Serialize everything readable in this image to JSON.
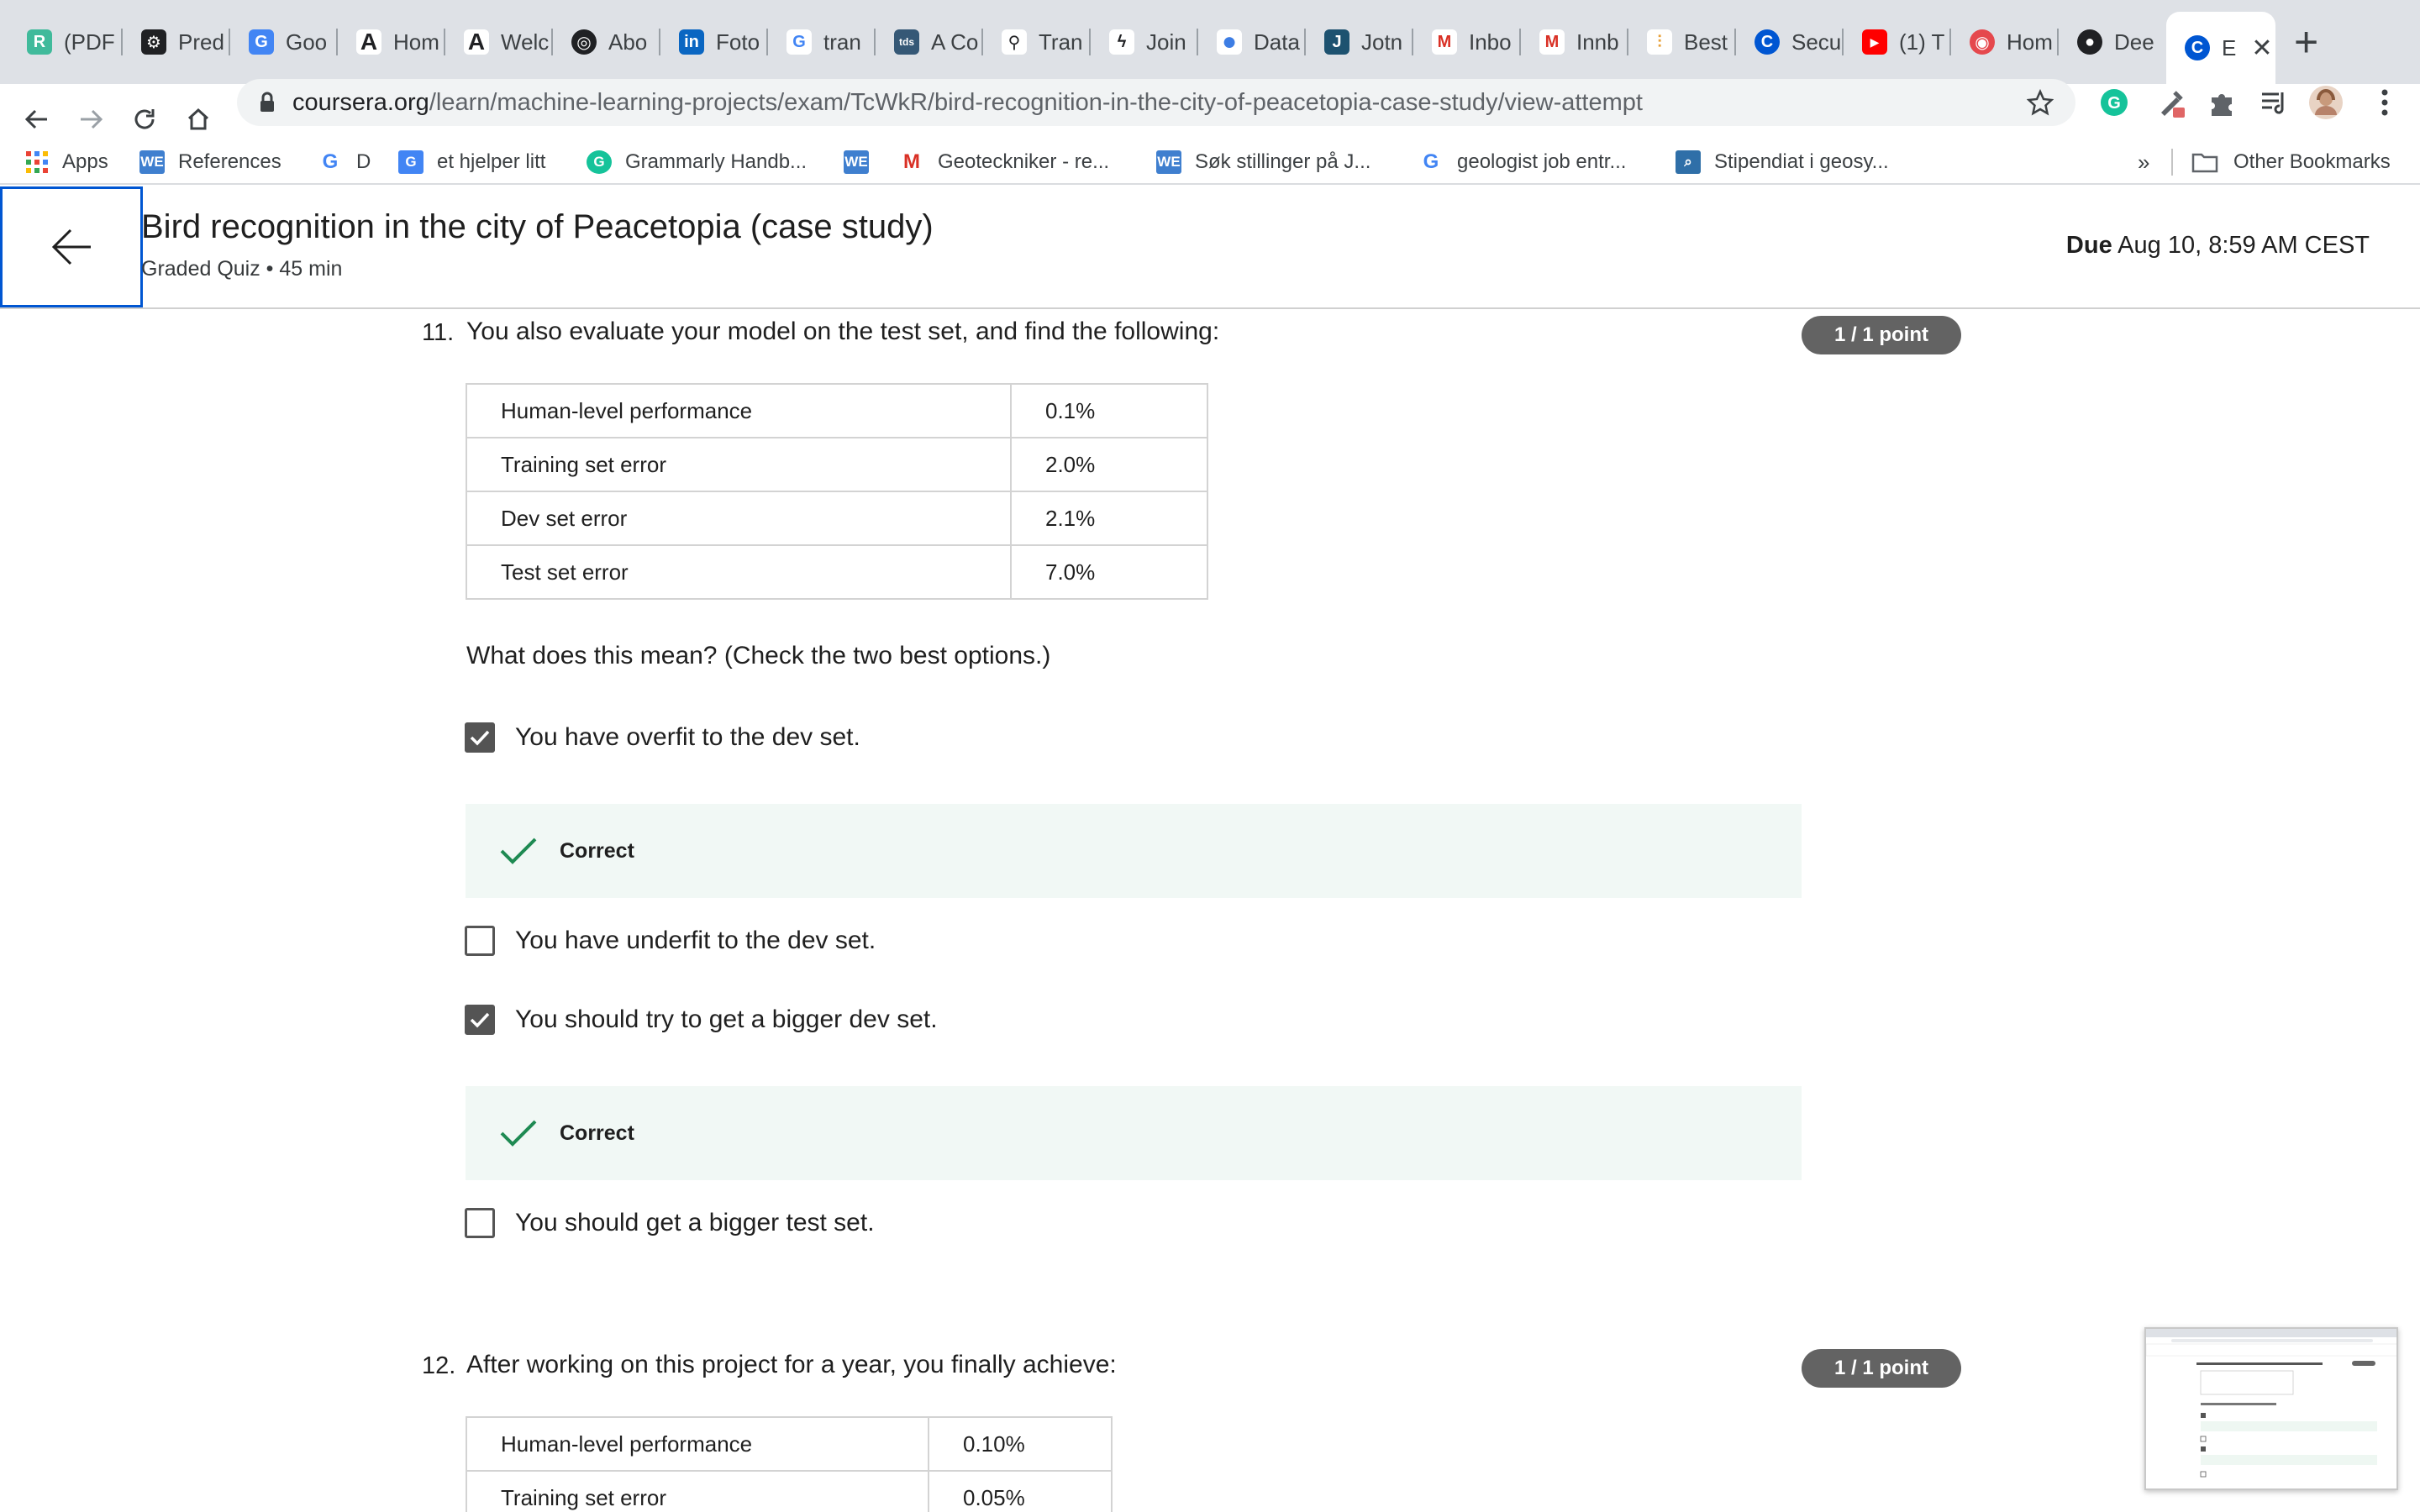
{
  "browser": {
    "tabs": [
      {
        "label": "(PDF",
        "icon": "researchgate-icon",
        "color": "#40ba9b",
        "glyph": "R"
      },
      {
        "label": "Pred",
        "icon": "gear-icon",
        "color": "#202124",
        "glyph": "⚙"
      },
      {
        "label": "Goo",
        "icon": "google-translate-icon",
        "color": "#4285f4",
        "glyph": "G"
      },
      {
        "label": "Hom",
        "icon": "anthropic-icon",
        "color": "#202124",
        "glyph": "A"
      },
      {
        "label": "Welc",
        "icon": "anthropic-icon",
        "color": "#202124",
        "glyph": "A"
      },
      {
        "label": "Abo",
        "icon": "openai-icon",
        "color": "#202124",
        "glyph": "◎"
      },
      {
        "label": "Foto",
        "icon": "linkedin-icon",
        "color": "#0a66c2",
        "glyph": "in"
      },
      {
        "label": "tran",
        "icon": "google-icon",
        "color": "#ffffff",
        "glyph": "G"
      },
      {
        "label": "A Co",
        "icon": "tds-icon",
        "color": "#355876",
        "glyph": "tds"
      },
      {
        "label": "Tran",
        "icon": "bike-icon",
        "color": "#ffffff",
        "glyph": "⚲"
      },
      {
        "label": "Join",
        "icon": "slash-icon",
        "color": "#ffffff",
        "glyph": "ϟ"
      },
      {
        "label": "Data",
        "icon": "drop-icon",
        "color": "#3d7de4",
        "glyph": "●"
      },
      {
        "label": "Jotn",
        "icon": "jotform-icon",
        "color": "#1d5270",
        "glyph": "J"
      },
      {
        "label": "Inbo",
        "icon": "gmail-icon",
        "color": "#ffffff",
        "glyph": "M"
      },
      {
        "label": "Innb",
        "icon": "gmail-icon",
        "color": "#ffffff",
        "glyph": "M"
      },
      {
        "label": "Best",
        "icon": "chart-icon",
        "color": "#ffffff",
        "glyph": "⫶"
      },
      {
        "label": "Secu",
        "icon": "coursera-icon",
        "color": "#0056d2",
        "glyph": "C"
      },
      {
        "label": "(1) T",
        "icon": "youtube-icon",
        "color": "#ff0000",
        "glyph": "▶"
      },
      {
        "label": "Hom",
        "icon": "target-icon",
        "color": "#e5484d",
        "glyph": "◉"
      },
      {
        "label": "Dee",
        "icon": "github-icon",
        "color": "#202124",
        "glyph": "●"
      },
      {
        "label": "E",
        "icon": "coursera-icon",
        "color": "#0056d2",
        "glyph": "C"
      }
    ],
    "url_host": "coursera.org",
    "url_path": "/learn/machine-learning-projects/exam/TcWkR/bird-recognition-in-the-city-of-peacetopia-case-study/view-attempt",
    "bookmarks": [
      {
        "label": "Apps",
        "icon": "apps-grid-icon"
      },
      {
        "label": "References",
        "icon": "we-icon"
      },
      {
        "label": "D",
        "icon": "google-icon"
      },
      {
        "label": "et hjelper litt",
        "icon": "google-translate-icon"
      },
      {
        "label": "Grammarly Handb...",
        "icon": "grammarly-icon"
      },
      {
        "label": "",
        "icon": "we-icon"
      },
      {
        "label": "Geoteckniker - re...",
        "icon": "gmail-icon"
      },
      {
        "label": "Søk stillinger på J...",
        "icon": "we-icon"
      },
      {
        "label": "geologist job entr...",
        "icon": "google-icon"
      },
      {
        "label": "Stipendiat i geosy...",
        "icon": "search-icon"
      }
    ],
    "bookmarks_overflow": "»",
    "other_bookmarks": "Other Bookmarks"
  },
  "header": {
    "title": "Bird recognition in the city of Peacetopia (case study)",
    "meta": "Graded Quiz • 45 min",
    "due_label": "Due",
    "due_value": "Aug 10, 8:59 AM CEST"
  },
  "q11": {
    "number": "11.",
    "text": "You also evaluate your model on the test set, and find the following:",
    "points": "1 / 1 point",
    "table": [
      {
        "label": "Human-level performance",
        "value": "0.1%"
      },
      {
        "label": "Training set error",
        "value": "2.0%"
      },
      {
        "label": "Dev set error",
        "value": "2.1%"
      },
      {
        "label": "Test set error",
        "value": "7.0%"
      }
    ],
    "prompt": "What does this mean? (Check the two best options.)",
    "options": [
      {
        "text": "You have overfit to the dev set.",
        "checked": true,
        "feedback": "Correct"
      },
      {
        "text": "You have underfit to the dev set.",
        "checked": false,
        "feedback": ""
      },
      {
        "text": "You should try to get a bigger dev set.",
        "checked": true,
        "feedback": "Correct"
      },
      {
        "text": "You should get a bigger test set.",
        "checked": false,
        "feedback": ""
      }
    ]
  },
  "q12": {
    "number": "12.",
    "text": "After working on this project for a year, you finally achieve:",
    "points": "1 / 1 point",
    "table": [
      {
        "label": "Human-level performance",
        "value": "0.10%"
      },
      {
        "label": "Training set error",
        "value": "0.05%"
      }
    ]
  },
  "colors": {
    "accent": "#0056d2",
    "correct_green": "#1e8a52",
    "feedback_bg": "#f1f8f5",
    "points_badge": "#636363"
  }
}
